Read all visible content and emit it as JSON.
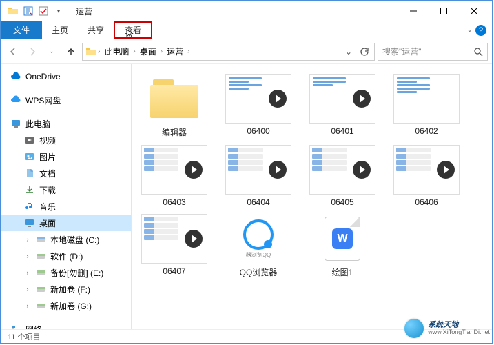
{
  "title": "运营",
  "ribbon": {
    "file": "文件",
    "home": "主页",
    "share": "共享",
    "view": "查看"
  },
  "breadcrumb": {
    "c1": "此电脑",
    "c2": "桌面",
    "c3": "运营"
  },
  "search": {
    "placeholder": "搜索\"运营\""
  },
  "tree": {
    "onedrive": "OneDrive",
    "wps": "WPS网盘",
    "thispc": "此电脑",
    "videos": "视频",
    "pictures": "图片",
    "documents": "文档",
    "downloads": "下载",
    "music": "音乐",
    "desktop": "桌面",
    "disk_c": "本地磁盘 (C:)",
    "disk_d": "软件 (D:)",
    "disk_e": "备份[勿删] (E:)",
    "disk_f": "新加卷 (F:)",
    "disk_g": "新加卷 (G:)",
    "network": "网络"
  },
  "items": {
    "folder1": "编辑器",
    "f06400": "06400",
    "f06401": "06401",
    "f06402": "06402",
    "f06403": "06403",
    "f06404": "06404",
    "f06405": "06405",
    "f06406": "06406",
    "f06407": "06407",
    "qq": "QQ浏览器",
    "qq_sub": "器浏览QQ",
    "wps1": "绘图1"
  },
  "status": {
    "count": "11 个项目"
  },
  "watermark": {
    "cn": "系统天地",
    "en": "www.XiTongTianDi.net"
  }
}
